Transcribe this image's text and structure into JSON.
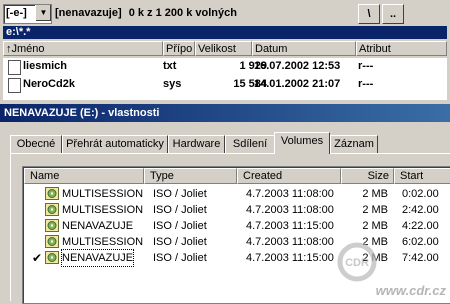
{
  "file_manager": {
    "drive_combo": "[-e-]",
    "drive_label": "[nenavazuje]",
    "free_space": "0 k z 1 200 k volných",
    "root_button": "\\",
    "up_button": "..",
    "path": "e:\\*.*",
    "columns": [
      "↑Jméno",
      "Přípo",
      "Velikost",
      "Datum",
      "Atribut"
    ],
    "files": [
      {
        "name": "liesmich",
        "ext": "txt",
        "size": "1 929",
        "date": "16.07.2002 12:53",
        "attr": "r---"
      },
      {
        "name": "NeroCd2k",
        "ext": "sys",
        "size": "15 584",
        "date": "14.01.2002 21:07",
        "attr": "r---"
      }
    ]
  },
  "dialog": {
    "title": "NENAVAZUJE (E:) - vlastnosti",
    "tabs": [
      "Obecné",
      "Přehrát automaticky",
      "Hardware",
      "Sdílení",
      "Volumes",
      "Záznam"
    ],
    "active_tab": "Volumes",
    "list_columns": [
      "Name",
      "Type",
      "Created",
      "Size",
      "Start"
    ],
    "sessions": [
      {
        "name": "MULTISESSION",
        "type": "ISO / Joliet",
        "created": "4.7.2003 11:08:00",
        "size": "2 MB",
        "start": "0:02.00",
        "checked": false
      },
      {
        "name": "MULTISESSION",
        "type": "ISO / Joliet",
        "created": "4.7.2003 11:08:00",
        "size": "2 MB",
        "start": "2:42.00",
        "checked": false
      },
      {
        "name": "NENAVAZUJE",
        "type": "ISO / Joliet",
        "created": "4.7.2003 11:15:00",
        "size": "2 MB",
        "start": "4:22.00",
        "checked": false
      },
      {
        "name": "MULTISESSION",
        "type": "ISO / Joliet",
        "created": "4.7.2003 11:08:00",
        "size": "2 MB",
        "start": "6:02.00",
        "checked": false
      },
      {
        "name": "NENAVAZUJE",
        "type": "ISO / Joliet",
        "created": "4.7.2003 11:15:00",
        "size": "2 MB",
        "start": "7:42.00",
        "checked": true
      }
    ]
  },
  "watermark": "www.cdr.cz",
  "watermark_logo": "CDR SERVER",
  "colors": {
    "titlebar": "#0a246a",
    "face": "#d4d0c8",
    "window": "#ffffff"
  }
}
